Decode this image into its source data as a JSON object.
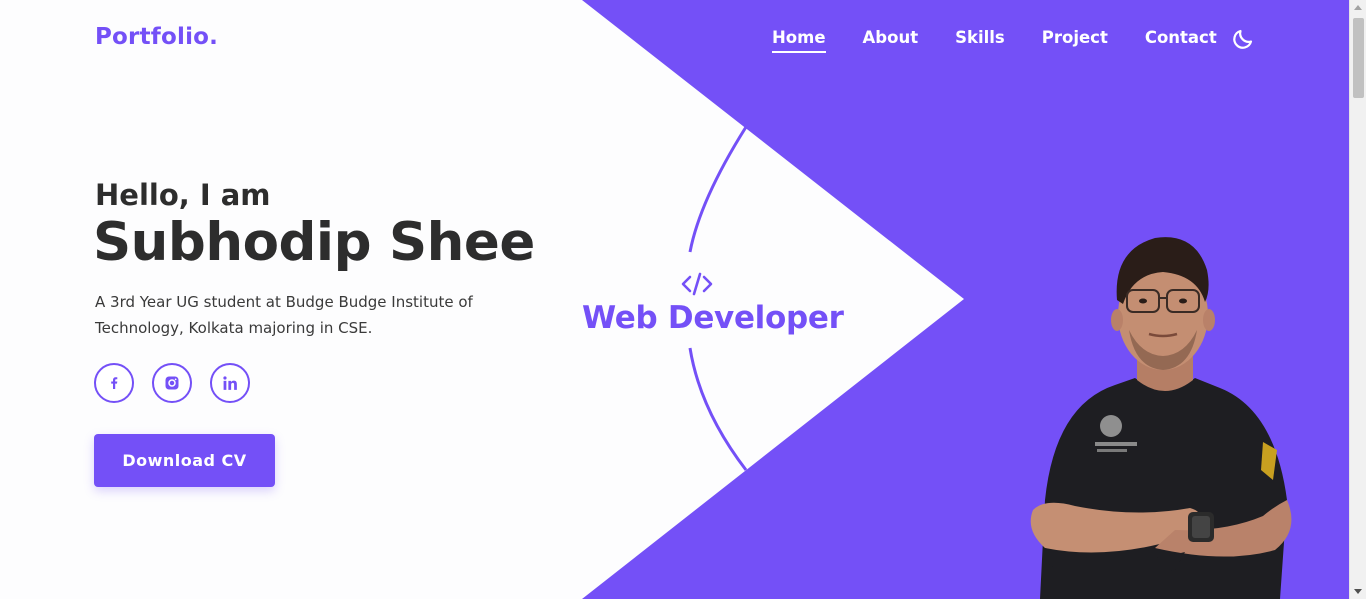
{
  "brand": {
    "logo_text": "Portfolio."
  },
  "nav": {
    "items": [
      {
        "label": "Home",
        "active": true
      },
      {
        "label": "About",
        "active": false
      },
      {
        "label": "Skills",
        "active": false
      },
      {
        "label": "Project",
        "active": false
      },
      {
        "label": "Contact",
        "active": false
      }
    ],
    "theme_toggle_icon": "moon-icon"
  },
  "hero": {
    "greeting": "Hello, I am",
    "name": "Subhodip Shee",
    "bio": "A 3rd Year UG student at Budge Budge Institute of Technology, Kolkata majoring in CSE.",
    "socials": [
      {
        "icon": "facebook-icon"
      },
      {
        "icon": "instagram-icon"
      },
      {
        "icon": "linkedin-icon"
      }
    ],
    "cta_label": "Download CV"
  },
  "showcase": {
    "code_icon": "code-icon",
    "role": "Web Developer"
  },
  "colors": {
    "accent": "#7450f7",
    "text_dark": "#2d2d2d",
    "background": "#fdfdfe"
  }
}
